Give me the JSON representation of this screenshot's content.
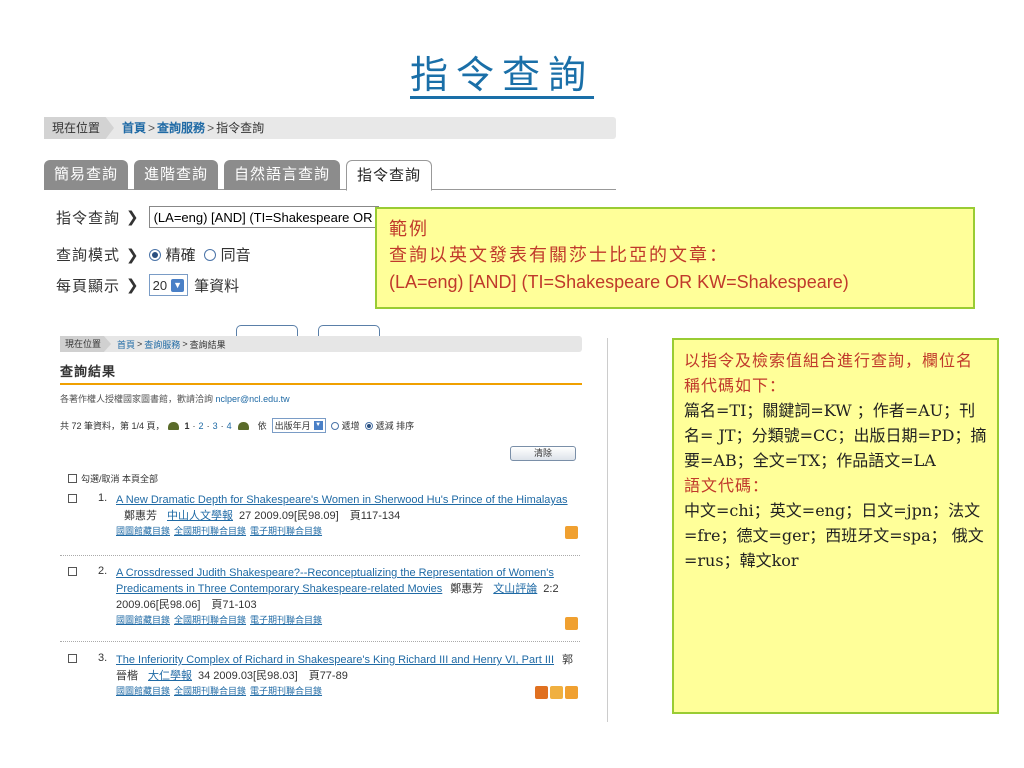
{
  "slide_title": "指令查詢",
  "breadcrumb": {
    "here": "現在位置",
    "home": "首頁",
    "service": "查詢服務",
    "current": "指令查詢",
    "sep": ">"
  },
  "tabs": [
    "簡易查詢",
    "進階查詢",
    "自然語言查詢",
    "指令查詢"
  ],
  "form": {
    "command_label": "指令查詢",
    "command_value": "(LA=eng) [AND] (TI=Shakespeare OR KW=Shakespeare)",
    "mode_label": "查詢模式",
    "mode_options": [
      "精確",
      "同音"
    ],
    "perpage_label": "每頁顯示",
    "perpage_value": "20",
    "perpage_unit": "筆資料",
    "arrow": "❯"
  },
  "example": {
    "title": "範例",
    "desc": "查詢以英文發表有關莎士比亞的文章：",
    "code": "(LA=eng) [AND] (TI=Shakespeare OR KW=Shakespeare)"
  },
  "results": {
    "breadcrumb": {
      "here": "現在位置",
      "home": "首頁",
      "service": "查詢服務",
      "current": "查詢結果"
    },
    "heading": "查詢結果",
    "note_prefix": "各著作權人授權國家圖書館，歡請洽詢 ",
    "note_email": "nclper@ncl.edu.tw",
    "stats": "共 72 筆資料，第 1/4 頁，",
    "pages": [
      "1",
      "2",
      "3",
      "4"
    ],
    "sort_label": "依",
    "sort_value": "出版年月",
    "sort_asc": "遞增",
    "sort_desc": "遞減 排序",
    "clear": "清除",
    "select_all": "勾選/取消 本頁全部",
    "catalogs": [
      "國圖館藏目錄",
      "全國期刊聯合目錄",
      "電子期刊聯合目錄"
    ],
    "items": [
      {
        "num": "1.",
        "title": "A New Dramatic Depth for Shakespeare's Women in Sherwood Hu's Prince of the Himalayas",
        "author": "鄭惠芳",
        "journal": "中山人文學報",
        "meta": "27 2009.09[民98.09]　頁117-134"
      },
      {
        "num": "2.",
        "title": "A Crossdressed Judith Shakespeare?--Reconceptualizing the Representation of Women's Predicaments in Three Contemporary Shakespeare-related Movies",
        "author": "鄭惠芳",
        "journal": "文山評論",
        "meta": "2:2 2009.06[民98.06]　頁71-103"
      },
      {
        "num": "3.",
        "title": "The Inferiority Complex of Richard in Shakespeare's King Richard III and Henry VI, Part III",
        "author": "郭晉楷",
        "journal": "大仁學報",
        "meta": "34 2009.03[民98.03]　頁77-89"
      }
    ]
  },
  "info": {
    "intro": "以指令及檢索值組合進行查詢，欄位名稱代碼如下：",
    "fields": "篇名=TI；關鍵詞=KW ；作者=AU；刊名= JT；分類號=CC；出版日期=PD；摘要=AB；全文=TX；作品語文=LA",
    "lang_heading": "語文代碼：",
    "langs": "中文=chi；英文=eng；日文=jpn；法文=fre；德文=ger；西班牙文=spa； 俄文=rus；韓文kor"
  }
}
